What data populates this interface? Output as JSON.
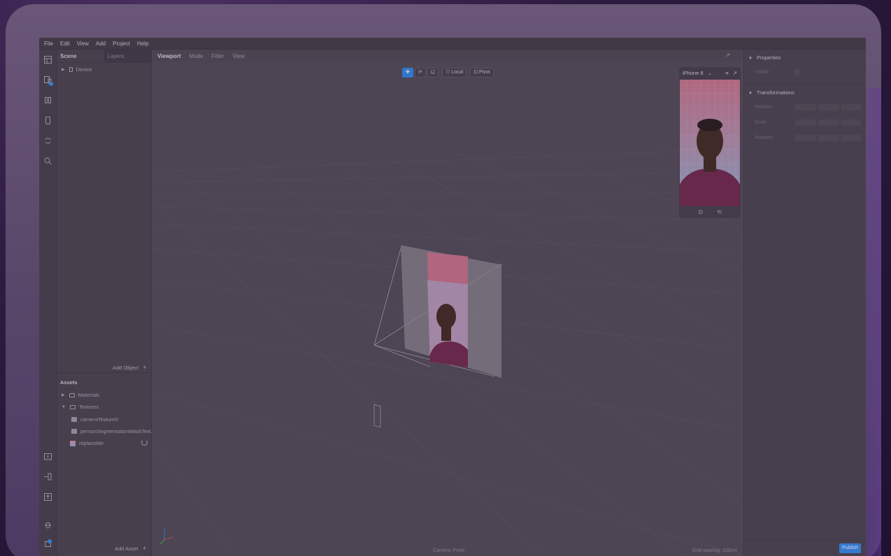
{
  "menu": [
    "File",
    "Edit",
    "View",
    "Add",
    "Project",
    "Help"
  ],
  "scene_panel": {
    "tabs": [
      "Scene",
      "Layers"
    ],
    "tree": [
      {
        "label": "Device"
      }
    ],
    "add_object_label": "Add Object"
  },
  "assets": {
    "title": "Assets",
    "items": [
      {
        "label": "Materials"
      },
      {
        "label": "Textures"
      },
      {
        "label": "cameraTexture0"
      },
      {
        "label": "personSegmentationMaskText..."
      },
      {
        "label": "replaceMe"
      }
    ],
    "add_asset_label": "Add Asset"
  },
  "viewport": {
    "tabs": [
      "Viewport",
      "Mode",
      "Filter",
      "View"
    ],
    "toolbar": {
      "local_label": "Local",
      "pivot_label": "Pivot"
    },
    "preview": {
      "device": "iPhone 8"
    },
    "status": {
      "camera": "Camera: Front",
      "grid": "Grid spacing: 100cm"
    }
  },
  "properties": {
    "title": "Properties",
    "visible_label": "Visible",
    "transformations_title": "Transformations",
    "fields": [
      "Position",
      "Scale",
      "Rotation"
    ],
    "publish_label": "Publish"
  },
  "colors": {
    "accent": "#2a82e0",
    "badge": "#2a8ae8"
  }
}
